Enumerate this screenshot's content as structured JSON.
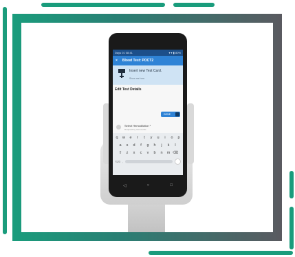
{
  "status_bar": {
    "time": "Days 01 08:41",
    "signals": "▾ ▾ ▮ 80%"
  },
  "app_bar": {
    "back": "×",
    "title": "Blood Test: POCT2"
  },
  "banner": {
    "title": "Insert new Test Card.",
    "subtitle": "Show me how"
  },
  "section": {
    "title": "Edit Test Details"
  },
  "toggle": {
    "label": "DONE"
  },
  "select_field": {
    "label": "Select Hemodilution *",
    "hint": "Required by test results"
  },
  "keyboard": {
    "row1": [
      "q",
      "w",
      "e",
      "r",
      "t",
      "y",
      "u",
      "i",
      "o",
      "p"
    ],
    "row2": [
      "a",
      "s",
      "d",
      "f",
      "g",
      "h",
      "j",
      "k",
      "l"
    ],
    "row3": [
      "⇧",
      "z",
      "x",
      "c",
      "v",
      "b",
      "n",
      "m",
      "⌫"
    ],
    "fn_left": "?123",
    "comma": ","
  },
  "nav": {
    "back": "◁",
    "home": "○",
    "recents": "□"
  },
  "colors": {
    "accent": "#2f83d6",
    "frame_teal": "#1a9c7c",
    "frame_gray": "#5a5a60"
  }
}
